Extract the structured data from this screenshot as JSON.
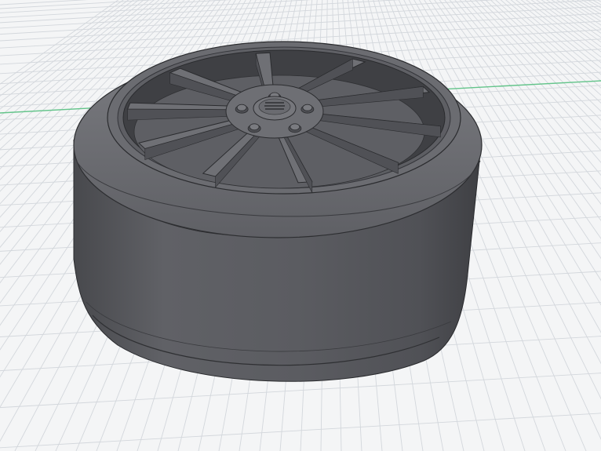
{
  "scene": {
    "background_color": "#f4f5f6",
    "grid_color": "#d3d7dc",
    "axis_color": "#63c48a",
    "model_color": "#5c5d61",
    "spoke_count": 10
  }
}
